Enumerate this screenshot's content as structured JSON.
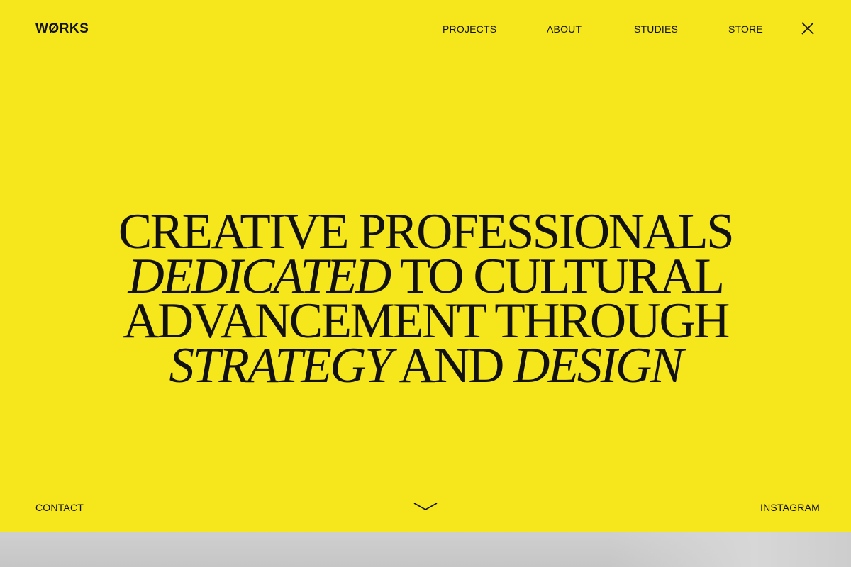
{
  "brand": {
    "logo_text": "WØRKS"
  },
  "nav": {
    "items": [
      {
        "label": "PROJECTS"
      },
      {
        "label": "ABOUT"
      },
      {
        "label": "STUDIES"
      },
      {
        "label": "STORE"
      }
    ],
    "close_icon": "close-icon"
  },
  "hero": {
    "line1": {
      "text": "CREATIVE PROFESSIONALS"
    },
    "line2": {
      "italic": "DEDICATED",
      "text": " TO CULTURAL"
    },
    "line3": {
      "text": "ADVANCEMENT THROUGH"
    },
    "line4": {
      "italic_a": "STRATEGY",
      "text": " AND ",
      "italic_b": "DESIGN"
    }
  },
  "footer": {
    "contact_label": "CONTACT",
    "instagram_label": "INSTAGRAM",
    "scroll_icon": "chevron-down-icon"
  },
  "colors": {
    "background": "#F6E61C",
    "text": "#111111",
    "next_section": "#C9C9C9"
  }
}
